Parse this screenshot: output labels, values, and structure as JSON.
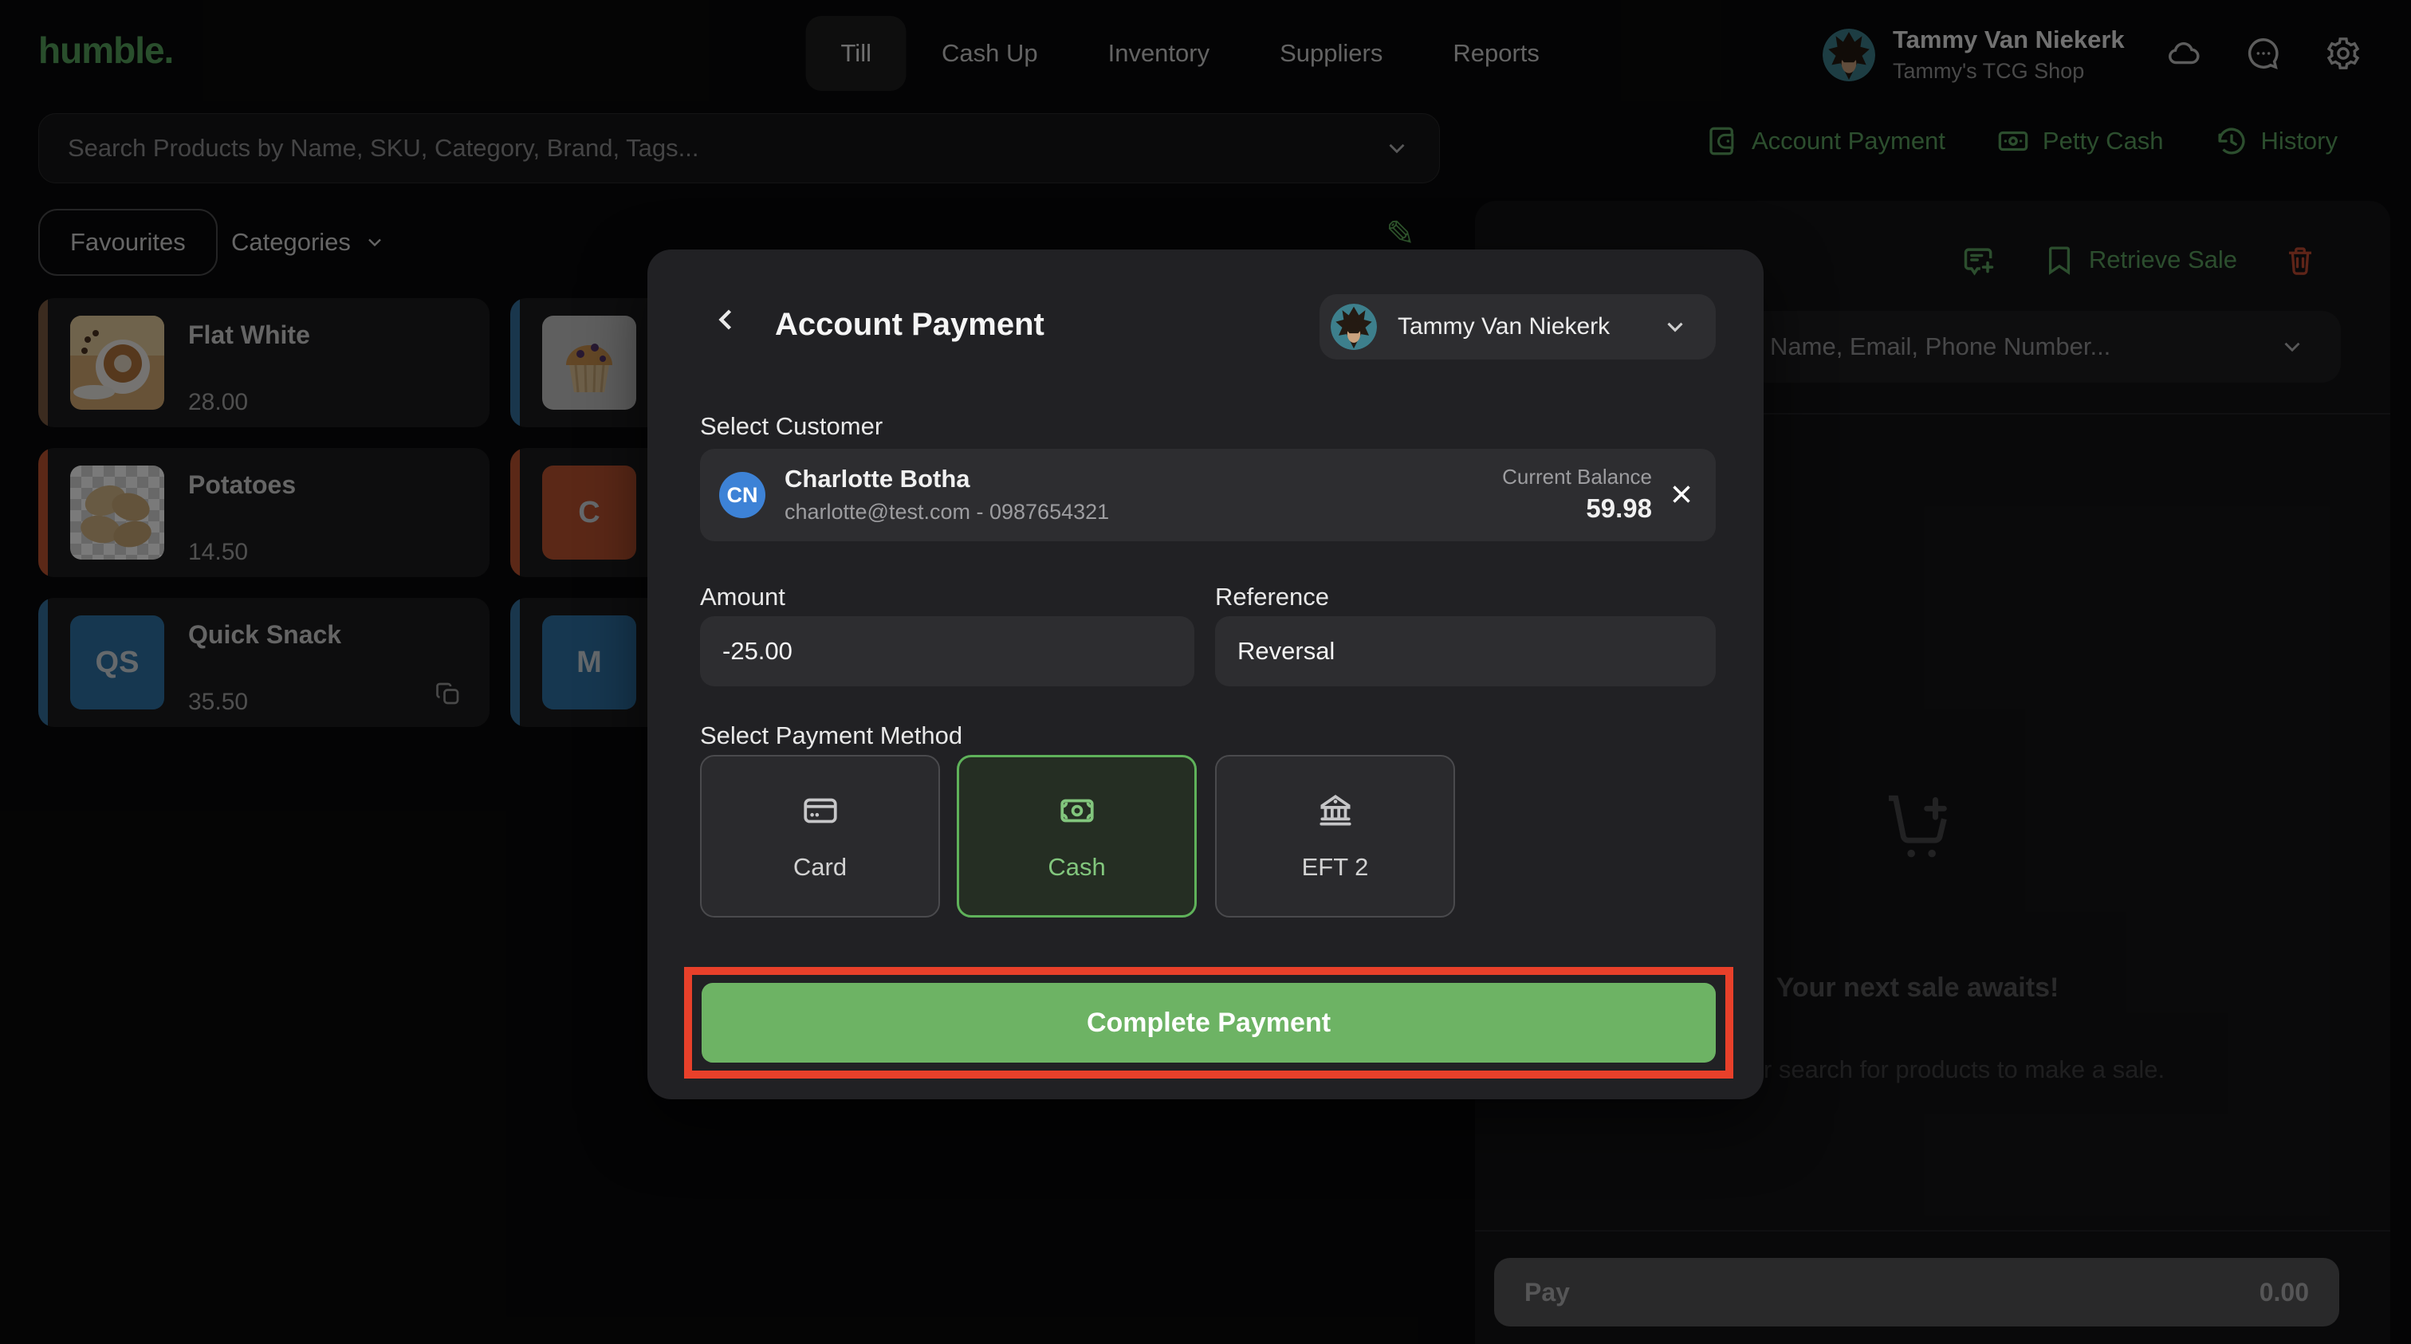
{
  "brand": {
    "logo_text": "humble."
  },
  "nav": {
    "tabs": [
      "Till",
      "Cash Up",
      "Inventory",
      "Suppliers",
      "Reports"
    ],
    "active_tab": "Till"
  },
  "user": {
    "name": "Tammy Van Niekerk",
    "shop": "Tammy's TCG Shop"
  },
  "search": {
    "placeholder": "Search Products by Name, SKU, Category, Brand, Tags..."
  },
  "filters": {
    "favourites_label": "Favourites",
    "categories_label": "Categories"
  },
  "products": [
    {
      "name": "Flat White",
      "price": "28.00",
      "stripe": "#7b5a42"
    },
    {
      "name": "Potatoes",
      "price": "14.50",
      "stripe": "#bf5530"
    },
    {
      "name": "Quick Snack",
      "price": "35.50",
      "stripe": "#35719f",
      "tile_text": "QS",
      "tile_color": "#2f74a8"
    },
    {
      "stripe": "#35719f"
    },
    {
      "tile_text": "C",
      "tile_color": "#bf5530",
      "stripe": "#bf5530"
    },
    {
      "tile_text": "M",
      "tile_color": "#2f74a8",
      "stripe": "#35719f"
    }
  ],
  "quick_actions": {
    "account_payment": "Account Payment",
    "petty_cash": "Petty Cash",
    "history": "History"
  },
  "sale_panel": {
    "retrieve_sale_label": "Retrieve Sale",
    "customer_search_placeholder": "Name, Email, Phone Number...",
    "empty_title": "Your next sale awaits!",
    "empty_subtitle_fragment": "r search for products to make a sale.",
    "pay_label": "Pay",
    "pay_amount": "0.00"
  },
  "modal": {
    "title": "Account Payment",
    "cashier_name": "Tammy Van Niekerk",
    "select_customer_label": "Select Customer",
    "customer": {
      "initials": "CN",
      "name": "Charlotte Botha",
      "contact": "charlotte@test.com - 0987654321",
      "balance_label": "Current Balance",
      "balance_value": "59.98"
    },
    "amount_label": "Amount",
    "amount_value": "-25.00",
    "reference_label": "Reference",
    "reference_value": "Reversal",
    "payment_method_label": "Select Payment Method",
    "methods": [
      {
        "label": "Card",
        "selected": false
      },
      {
        "label": "Cash",
        "selected": true
      },
      {
        "label": "EFT 2",
        "selected": false
      }
    ],
    "complete_label": "Complete Payment"
  },
  "colors": {
    "accent_green": "#5da361",
    "button_green": "#6db364",
    "selected_green": "#5fb25a",
    "highlight_red": "#e8402a",
    "trash_red": "#c44b33",
    "customer_avatar_blue": "#3d82d6"
  },
  "icons": [
    "cloud-icon",
    "chat-icon",
    "gear-icon",
    "chevron-down-icon",
    "pencil-icon",
    "copy-icon",
    "wallet-icon",
    "banknote-icon",
    "history-icon",
    "note-add-icon",
    "bookmark-icon",
    "trash-icon",
    "cart-plus-icon",
    "back-chevron-icon",
    "close-icon",
    "credit-card-icon",
    "bank-icon"
  ]
}
